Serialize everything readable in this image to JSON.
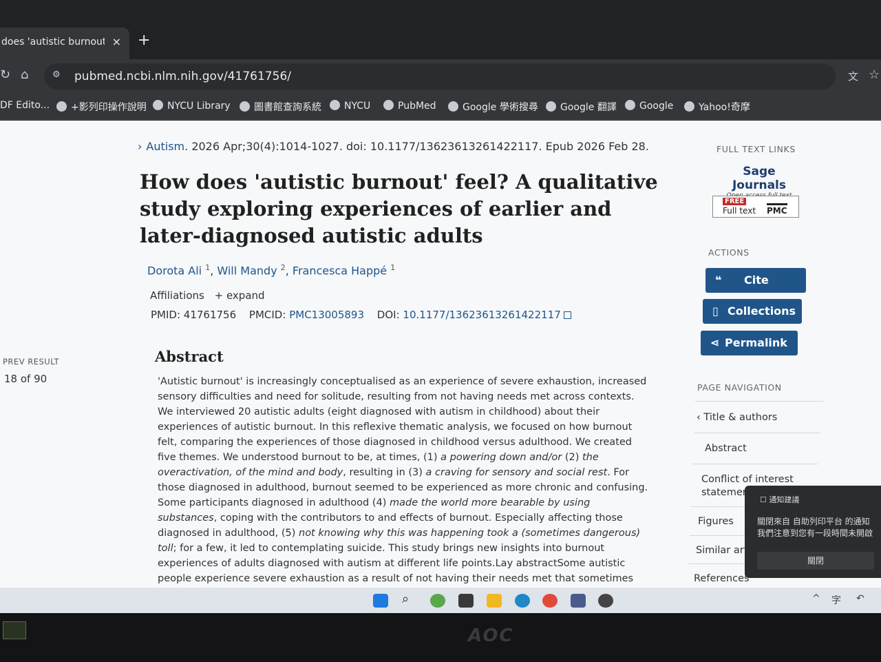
{
  "browser": {
    "tab_title": "does 'autistic burnout' fe",
    "tab_close": "×",
    "new_tab": "+",
    "url": "pubmed.ncbi.nlm.nih.gov/41761756/",
    "bookmarks": [
      "DF Edito...",
      "+影列印操作說明",
      "NYCU Library",
      "圖書館查詢系統",
      "NYCU",
      "PubMed",
      "Google 學術搜尋",
      "Google 翻譯",
      "Google",
      "Yahoo!奇摩"
    ]
  },
  "article": {
    "journal": "Autism",
    "citation_rest": ". 2026 Apr;30(4):1014-1027. doi: 10.1177/13623613261422117. Epub 2026 Feb 28.",
    "title": "How does 'autistic burnout' feel? A qualitative study exploring experiences of earlier and later-diagnosed autistic adults",
    "authors": [
      {
        "name": "Dorota Ali",
        "sup": "1"
      },
      {
        "name": "Will Mandy",
        "sup": "2"
      },
      {
        "name": "Francesca Happé",
        "sup": "1"
      }
    ],
    "affiliations_label": "Affiliations",
    "expand_label": "+ expand",
    "pmid_label": "PMID: 41761756",
    "pmcid_label": "PMCID:",
    "pmcid_value": "PMC13005893",
    "doi_label": "DOI:",
    "doi_value": "10.1177/13623613261422117",
    "abstract_heading": "Abstract",
    "abstract_parts": [
      "'Autistic burnout' is increasingly conceptualised as an experience of severe exhaustion, increased sensory difficulties and need for solitude, resulting from not having needs met across contexts. We interviewed 20 autistic adults (eight diagnosed with autism in childhood) about their experiences of autistic burnout. In this reflexive thematic analysis, we focused on how burnout felt, comparing the experiences of those diagnosed in childhood versus adulthood. We created five themes. We understood burnout to be, at times, (1) ",
      "a powering down and/or",
      " (2) ",
      "the overactivation, of the mind and body",
      ", resulting in (3) ",
      "a craving for sensory and social rest",
      ". For those diagnosed in adulthood, burnout seemed to be experienced as more chronic and confusing. Some participants diagnosed in adulthood (4) ",
      "made the world more bearable by using substances",
      ", coping with the contributors to and effects of burnout. Especially affecting those diagnosed in adulthood, (5) ",
      "not knowing why this was happening took a (sometimes dangerous) toll",
      "; for a few, it led to contemplating suicide. This study brings new insights into burnout experiences of adults diagnosed with autism at different life points.Lay abstractSome autistic people experience severe exhaustion as a result of not having their needs met that sometimes prevents them from being able to take part in daily life. Some people refer to this as"
    ]
  },
  "left": {
    "prev_label": "PREV RESULT",
    "prev_count": "18 of 90"
  },
  "sidebar": {
    "full_text_heading": "FULL TEXT LINKS",
    "sage_brand": "Sage Journals",
    "sage_sub": "Open access full text",
    "pmc_free": "FREE",
    "pmc_full_text": "Full text",
    "pmc_label": "PMC",
    "actions_heading": "ACTIONS",
    "cite": "Cite",
    "collections": "Collections",
    "permalink": "Permalink",
    "page_nav_heading": "PAGE NAVIGATION",
    "nav_items": [
      "Title & authors",
      "Abstract",
      "Conflict of interest statement",
      "Figures",
      "Similar arti",
      "References"
    ]
  },
  "toast": {
    "header": "通知建議",
    "line1": "關閉來自 自助列印平台 的通知",
    "line2": "我們注意到您有一段時間未開啟",
    "button": "關閉"
  },
  "monitor": {
    "brand": "AOC"
  }
}
